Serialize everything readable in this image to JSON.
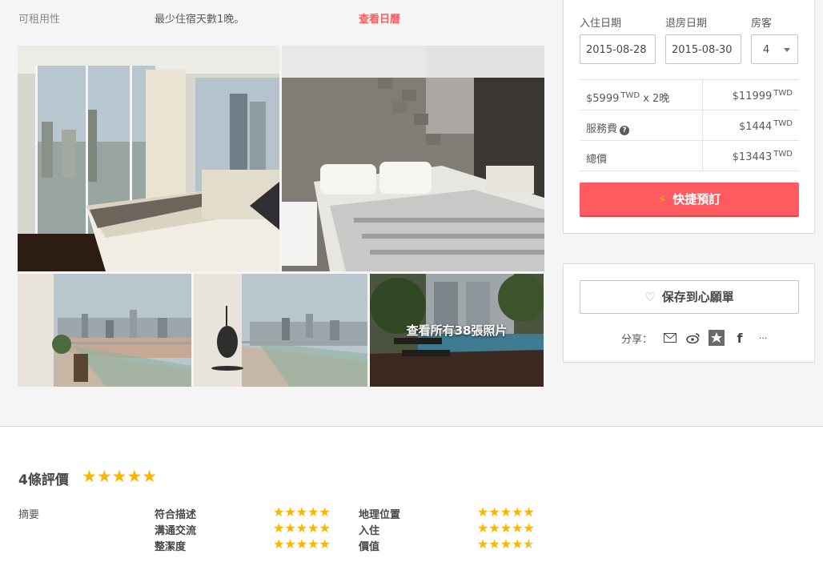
{
  "availability": {
    "label": "可租用性",
    "min_nights": "最少住宿天數1晚。",
    "calendar_link": "查看日曆"
  },
  "photos": {
    "see_all": "查看所有38張照片"
  },
  "booking": {
    "checkin_label": "入住日期",
    "checkout_label": "退房日期",
    "guests_label": "房客",
    "checkin_value": "2015-08-28",
    "checkout_value": "2015-08-30",
    "guests_value": "4",
    "rows": [
      {
        "label": "$5999",
        "label_sup": "TWD",
        "label_suffix": " x 2晚",
        "value": "$11999",
        "value_sup": "TWD"
      },
      {
        "label": "服務費",
        "value": "$1444",
        "value_sup": "TWD"
      },
      {
        "label": "總價",
        "value": "$13443",
        "value_sup": "TWD"
      }
    ],
    "instant_book": "快捷預訂",
    "accent_color": "#ff5a5f"
  },
  "wishlist": {
    "save_label": "保存到心願單",
    "share_label": "分享：",
    "share_icons": [
      "mail-icon",
      "weibo-icon",
      "qzone-icon",
      "facebook-icon",
      "more-icon"
    ],
    "more": "···"
  },
  "reviews": {
    "title": "4條評價",
    "overall_rating": 5,
    "summary_label": "摘要",
    "categories": [
      {
        "label": "符合描述",
        "rating": 5
      },
      {
        "label": "溝通交流",
        "rating": 5
      },
      {
        "label": "整潔度",
        "rating": 5
      },
      {
        "label": "地理位置",
        "rating": 5
      },
      {
        "label": "入住",
        "rating": 5
      },
      {
        "label": "價值",
        "rating": 4.5
      }
    ],
    "star_color": "#ffb400"
  }
}
